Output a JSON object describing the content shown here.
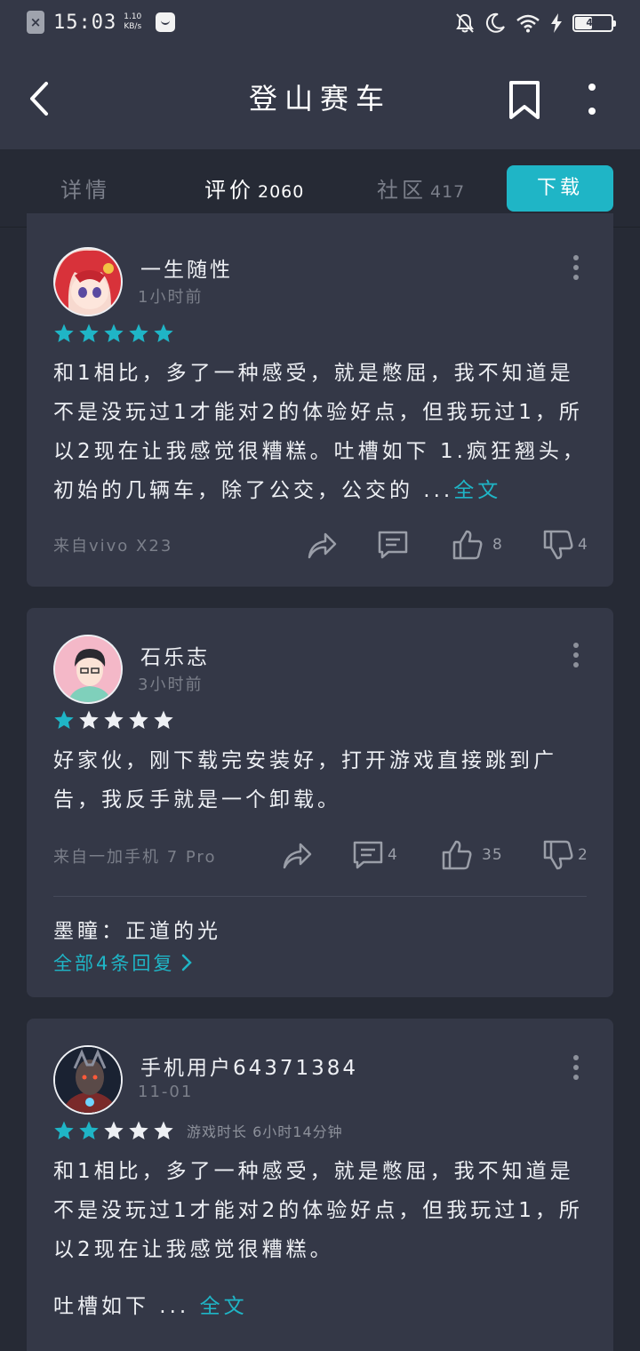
{
  "status_bar": {
    "time": "15:03",
    "net_speed_value": "1.10",
    "net_speed_unit": "KB/s",
    "battery": "47"
  },
  "app_bar": {
    "title": "登山赛车"
  },
  "tabs": [
    {
      "label": "详情",
      "count": ""
    },
    {
      "label": "评价",
      "count": "2060"
    },
    {
      "label": "社区",
      "count": "417"
    }
  ],
  "active_tab": 1,
  "download_label": "下载",
  "colors": {
    "accent": "#1fb5c6",
    "card_bg": "#343847",
    "page_bg": "#262a35",
    "star_off": "#eef0f4"
  },
  "reviews": [
    {
      "username": "一生随性",
      "time": "1小时前",
      "rating": 5,
      "playtime": "",
      "text": "和1相比，多了一种感受，就是憋屈，我不知道是不是没玩过1才能对2的体验好点，但我玩过1，所以2现在让我感觉很糟糕。吐槽如下 1.疯狂翘头，初始的几辆车，除了公交，公交的 ...",
      "read_more": "全文",
      "device": "来自vivo X23",
      "comments": "",
      "likes": "8",
      "dislikes": "4"
    },
    {
      "username": "石乐志",
      "time": "3小时前",
      "rating": 1,
      "playtime": "",
      "text": "好家伙，刚下载完安装好，打开游戏直接跳到广告，我反手就是一个卸载。",
      "device": "来自一加手机 7 Pro",
      "comments": "4",
      "likes": "35",
      "dislikes": "2",
      "reply": "墨瞳：正道的光",
      "all_replies": "全部4条回复"
    },
    {
      "username": "手机用户64371384",
      "time": "11-01",
      "rating": 2,
      "playtime": "游戏时长 6小时14分钟",
      "text": "和1相比，多了一种感受，就是憋屈，我不知道是不是没玩过1才能对2的体验好点，但我玩过1，所以2现在让我感觉很糟糕。",
      "text_2": "吐槽如下 ...",
      "read_more": "全文"
    }
  ]
}
